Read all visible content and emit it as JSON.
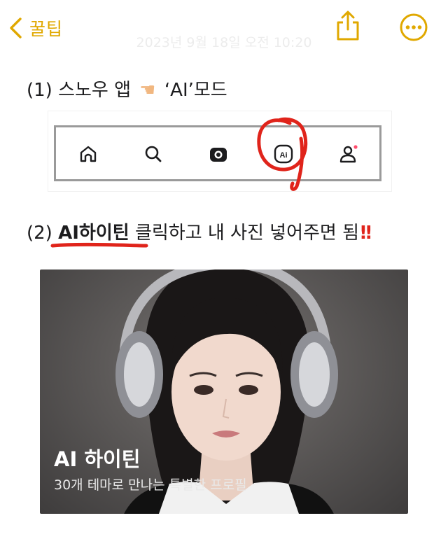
{
  "nav": {
    "back_label": "꿀팁",
    "back_icon": "chevron-left-icon",
    "share_icon": "share-icon",
    "more_icon": "ellipsis-circle-icon",
    "accent_color": "#e0a800"
  },
  "note": {
    "timestamp": "2023년 9월 18일 오전 10:20",
    "step1": {
      "prefix": "(1) 스노우 앱",
      "pointer_emoji": "☛",
      "suffix": "‘AI’모드"
    },
    "tab_bar": {
      "tabs": [
        {
          "icon": "home-icon"
        },
        {
          "icon": "search-icon"
        },
        {
          "icon": "camera-icon"
        },
        {
          "icon": "ai-icon",
          "label": "Ai"
        },
        {
          "icon": "profile-icon"
        }
      ]
    },
    "step2": {
      "prefix": "(2)",
      "highlight": "AI하이틴",
      "suffix": "클릭하고 내 사진 넣어주면 됨",
      "emoji": "!!"
    },
    "card": {
      "title": "AI 하이틴",
      "subtitle": "30개 테마로 만나는 특별한 프로필"
    }
  },
  "colors": {
    "annotation_red": "#e0241b",
    "text": "#1c1c1e"
  }
}
